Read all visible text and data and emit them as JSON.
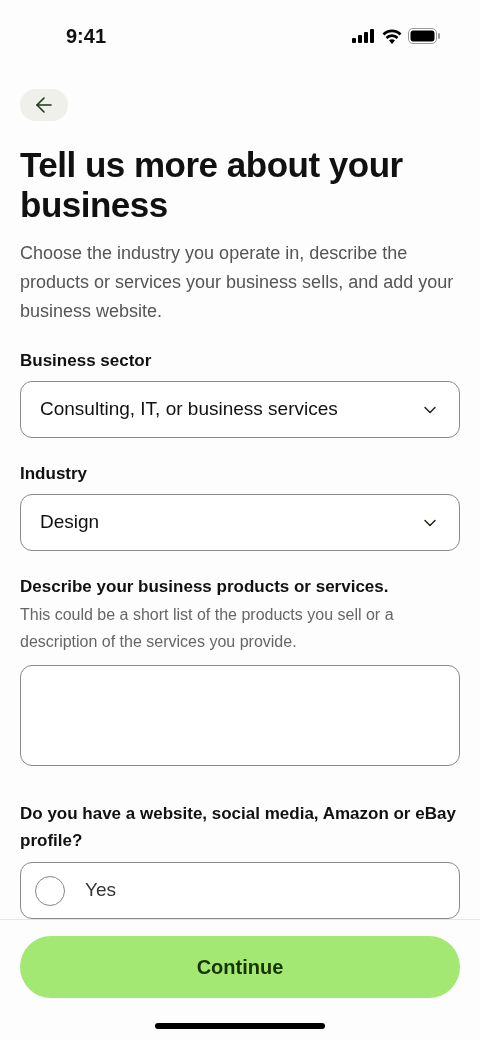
{
  "status_bar": {
    "time": "9:41"
  },
  "title": "Tell us more about your business",
  "description": "Choose the industry you operate in, describe the products or services your business sells, and add your business website.",
  "fields": [
    {
      "kind": "select",
      "label": "Business sector",
      "value": "Consulting, IT, or business services"
    },
    {
      "kind": "select",
      "label": "Industry",
      "value": "Design"
    },
    {
      "kind": "textarea",
      "label": "Describe your business products or services.",
      "hint": "This could be a short list of the products you sell or a description of the services you provide."
    },
    {
      "kind": "radio",
      "label": "Do you have a website, social media, Amazon or eBay profile?",
      "options": [
        {
          "label": "Yes",
          "selected": false
        }
      ]
    }
  ],
  "continue_button": "Continue"
}
